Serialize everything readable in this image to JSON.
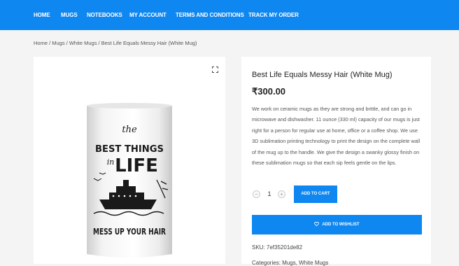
{
  "nav": {
    "items": [
      {
        "label": "HOME"
      },
      {
        "label": "MUGS"
      },
      {
        "label": "NOTEBOOKS"
      },
      {
        "label": "MY ACCOUNT"
      },
      {
        "label": "TERMS AND CONDITIONS"
      },
      {
        "label": "TRACK MY ORDER"
      }
    ]
  },
  "breadcrumb": "Home / Mugs / White Mugs / Best Life Equals Messy Hair (White Mug)",
  "product": {
    "title": "Best Life Equals Messy Hair (White Mug)",
    "price": "₹300.00",
    "description": "We work on ceramic mugs as they are strong and brittle, and can go in microwave and dishwasher. 11 ounce (330 ml) capacity of our mugs is just right for a person for regular use at home, office or a coffee shop. We use 3D sublimation printing technology to print the design on the complete wall of the mug up to the handle. We give the design a swanky glossy finish on these sublimation mugs so that each sip feels gentle on the lips.",
    "quantity": "1",
    "minus": "−",
    "plus": "+",
    "add_to_cart": "ADD TO CART",
    "add_to_wishlist": "ADD TO WISHLIST",
    "sku": "SKU: 7ef35201de82",
    "categories": "Categories: Mugs, White Mugs"
  },
  "mug_print": {
    "line1": "the",
    "line2": "BEST THINGS",
    "line3": "in",
    "line4": "LIFE",
    "line5": "MESS UP YOUR HAIR"
  },
  "colors": {
    "accent": "#0f87f0"
  }
}
